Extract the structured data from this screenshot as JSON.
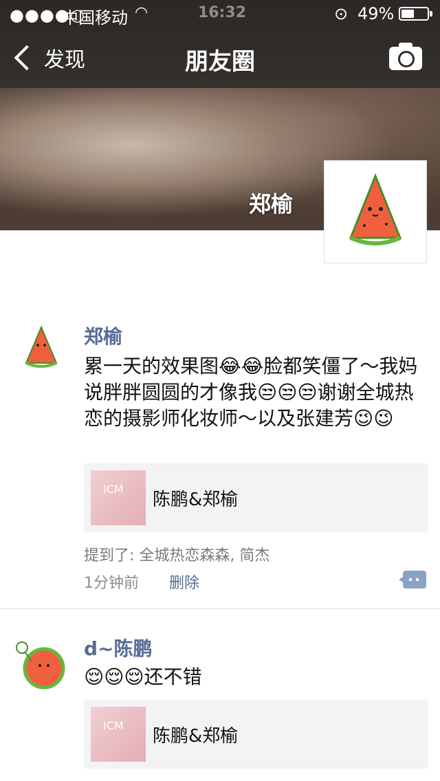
{
  "status_bar": {
    "signal": "●●●●○",
    "carrier": "中国移动",
    "time": "16:32",
    "battery": "49%",
    "battery_level": 0.49
  },
  "nav": {
    "back_label": "发现",
    "title": "朋友圈"
  },
  "profile": {
    "name": "郑榆"
  },
  "posts": [
    {
      "author": "郑榆",
      "text": "累一天的效果图😂😂脸都笑僵了～我妈说胖胖圆圆的才像我😒😒😒谢谢全城热恋的摄影师化妆师～以及张建芳😉😉",
      "link_title": "陈鹏&郑榆",
      "mentions": "提到了: 全城热恋森森, 简杰",
      "time": "1分钟前",
      "delete": "删除"
    },
    {
      "author": "d~陈鹏",
      "text": "😌😌😌还不错",
      "link_title": "陈鹏&郑榆"
    }
  ]
}
